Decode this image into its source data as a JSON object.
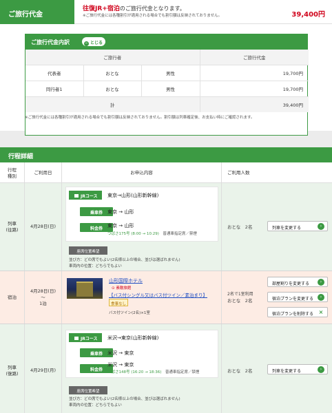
{
  "fare": {
    "label": "ご旅行代金",
    "route_highlight": "往復JR+宿泊",
    "route_suffix": "のご旅行代金となります。",
    "note": "※ご旅行代金には各種割引が適用される場合でも割引額は反映されておりません。",
    "total": "39,400円"
  },
  "breakdown": {
    "title": "ご旅行代金内訳",
    "close_label": "とじる",
    "headers": {
      "traveler": "ご旅行者",
      "price": "ご旅行代金"
    },
    "rows": [
      {
        "role": "代表者",
        "age": "おとな",
        "gender": "男性",
        "price": "19,700円"
      },
      {
        "role": "同行者1",
        "age": "おとな",
        "gender": "男性",
        "price": "19,700円"
      }
    ],
    "total_label": "計",
    "total_value": "39,400円",
    "note": "※ご旅行代金には各種割引が適用される場合でも割引額は反映されておりません。割引額は列車確定後、お支払い時にご確認されます。"
  },
  "itinerary": {
    "title": "行程詳細",
    "headers": {
      "type": "行程\n種別",
      "date": "ご利用日",
      "content": "お申込内容",
      "persons": "ご利用人数"
    },
    "rows": [
      {
        "type": "列車",
        "type_sub": "(往路)",
        "date": "4月28日(日)",
        "course_tag": "JRコース",
        "course": "東京→山形(山形新幹線)",
        "ticket1_label": "乗車券",
        "ticket1_route": "東京 → 山形",
        "ticket2_label": "料金券",
        "ticket2_route": "東京 → 山形",
        "train": "つばさ175号 (8:00 → 10:29)",
        "seat_info": "普通車指定席／禁煙",
        "seat_req": "座席位置希望",
        "seat_row1": "並び方：どの席でもよい(2名様以上の場合、並びは選ばれません)",
        "seat_row2": "車両内の位置：どちらでもよい",
        "persons": "おとな　2名",
        "button": "列車を変更する"
      },
      {
        "type": "宿泊",
        "date": "4月28日(日)",
        "date_sep": "〜",
        "nights": "1泊",
        "hotel": "山形国際ホテル",
        "hotel_badge": "⊙ 素敵旅館",
        "plan": "【バス付シングル又はバス付ツイン／素泊まり】",
        "meal_badge": "食事なし",
        "room": "バス付ツイン(2名)×1室",
        "persons_line1": "2名で1室利用",
        "persons_line2": "おとな　2名",
        "btn1": "部屋割りを変更する",
        "btn2": "宿泊プランを変更する",
        "btn3": "宿泊プランを削除する"
      },
      {
        "type": "列車",
        "type_sub": "(復路)",
        "date": "4月29日(月)",
        "course_tag": "JRコース",
        "course": "米沢→東京(山形新幹線)",
        "ticket1_label": "乗車券",
        "ticket1_route": "米沢 → 東京",
        "ticket2_label": "料金券",
        "ticket2_route": "米沢 → 東京",
        "train": "つばさ148号 (16:20 → 18:36)",
        "seat_info": "普通車指定席／禁煙",
        "seat_req": "座席位置希望",
        "seat_row1": "並び方：どの席でもよい(2名様以上の場合、並びは選ばれません)",
        "seat_row2": "車両内の位置：どちらでもよい",
        "persons": "おとな　2名",
        "button": "列車を変更する"
      }
    ]
  },
  "colors": {
    "accent": "#3c9a43",
    "price": "#d0021b",
    "hotel_row": "#fdece4",
    "train_row": "#eaf3ea"
  }
}
